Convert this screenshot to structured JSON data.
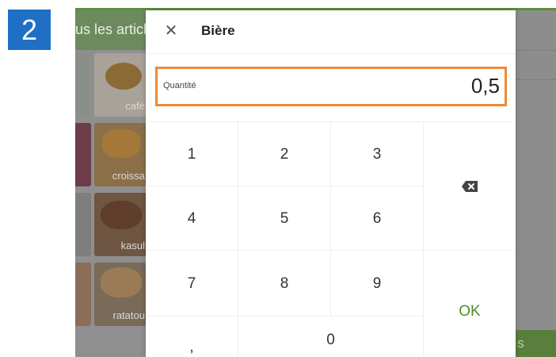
{
  "step_badge": "2",
  "background": {
    "header_text": "us les articl",
    "items": [
      {
        "label": "café"
      },
      {
        "label": "croissa"
      },
      {
        "label": "kasul"
      },
      {
        "label": "ratatou"
      }
    ],
    "green_button_text": "S"
  },
  "dialog": {
    "close_icon": "close-icon",
    "title": "Bière",
    "quantity": {
      "label": "Quantité",
      "value": "0,5"
    },
    "keypad": {
      "keys": [
        "1",
        "2",
        "3",
        "4",
        "5",
        "6",
        "7",
        "8",
        "9",
        ",",
        "0"
      ],
      "backspace_icon": "backspace-icon",
      "ok_label": "OK"
    }
  },
  "colors": {
    "badge": "#1f6fc4",
    "quantity_border": "#ee8a33",
    "ok_text": "#4f8f2a",
    "app_green": "#5e8f3a"
  }
}
